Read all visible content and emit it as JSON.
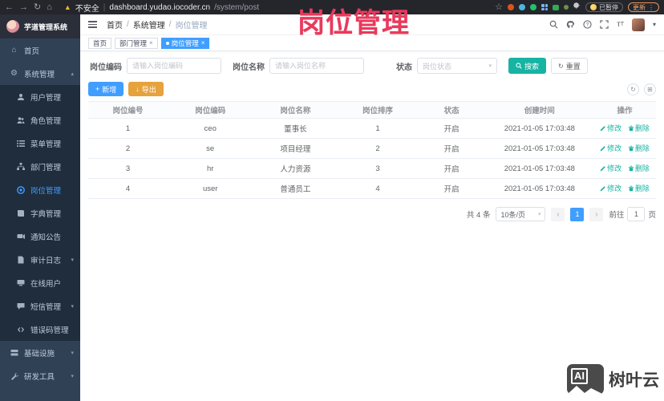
{
  "browser": {
    "security_label": "不安全",
    "url_host": "dashboard.yudao.iocoder.cn",
    "url_path": "/system/post",
    "extension_badge": "已暂停",
    "update_label": "更新"
  },
  "annotation": "岗位管理",
  "sidebar": {
    "app_title": "芋道管理系统",
    "menu": [
      {
        "label": "首页",
        "icon": "home-icon"
      },
      {
        "label": "系统管理",
        "icon": "gear-icon"
      }
    ],
    "submenu": [
      {
        "label": "用户管理",
        "icon": "user-icon"
      },
      {
        "label": "角色管理",
        "icon": "users-icon"
      },
      {
        "label": "菜单管理",
        "icon": "menu-list-icon"
      },
      {
        "label": "部门管理",
        "icon": "org-tree-icon"
      },
      {
        "label": "岗位管理",
        "icon": "post-icon"
      },
      {
        "label": "字典管理",
        "icon": "book-icon"
      },
      {
        "label": "通知公告",
        "icon": "megaphone-icon"
      },
      {
        "label": "审计日志",
        "icon": "audit-icon"
      },
      {
        "label": "在线用户",
        "icon": "online-icon"
      },
      {
        "label": "短信管理",
        "icon": "message-icon"
      },
      {
        "label": "错误码管理",
        "icon": "code-icon"
      }
    ],
    "bottom": [
      {
        "label": "基础设施",
        "icon": "server-icon"
      },
      {
        "label": "研发工具",
        "icon": "tools-icon"
      }
    ]
  },
  "header": {
    "breadcrumb": [
      "首页",
      "系统管理",
      "岗位管理"
    ]
  },
  "tags": [
    {
      "label": "首页"
    },
    {
      "label": "部门管理"
    },
    {
      "label": "岗位管理"
    }
  ],
  "search": {
    "code_label": "岗位编码",
    "code_placeholder": "请输入岗位编码",
    "name_label": "岗位名称",
    "name_placeholder": "请输入岗位名称",
    "status_label": "状态",
    "status_placeholder": "岗位状态",
    "search_button": "搜索",
    "reset_button": "重置"
  },
  "toolbar": {
    "add_button": "新增",
    "export_button": "导出"
  },
  "table": {
    "headers": [
      "岗位编号",
      "岗位编码",
      "岗位名称",
      "岗位排序",
      "状态",
      "创建时间",
      "操作"
    ],
    "rows": [
      [
        "1",
        "ceo",
        "董事长",
        "1",
        "开启",
        "2021-01-05 17:03:48"
      ],
      [
        "2",
        "se",
        "项目经理",
        "2",
        "开启",
        "2021-01-05 17:03:48"
      ],
      [
        "3",
        "hr",
        "人力资源",
        "3",
        "开启",
        "2021-01-05 17:03:48"
      ],
      [
        "4",
        "user",
        "普通员工",
        "4",
        "开启",
        "2021-01-05 17:03:48"
      ]
    ],
    "actions": {
      "edit": "修改",
      "delete": "删除"
    }
  },
  "pagination": {
    "total": "共 4 条",
    "page_size": "10条/页",
    "current_page": "1",
    "goto_prefix": "前往",
    "goto_value": "1",
    "goto_suffix": "页"
  },
  "watermark": {
    "logo_text": "AI",
    "brand": "树叶云"
  },
  "colors": {
    "primary": "#409eff",
    "teal": "#17b3a3",
    "warning": "#e6a23c",
    "danger_annotation": "#e9395c"
  }
}
